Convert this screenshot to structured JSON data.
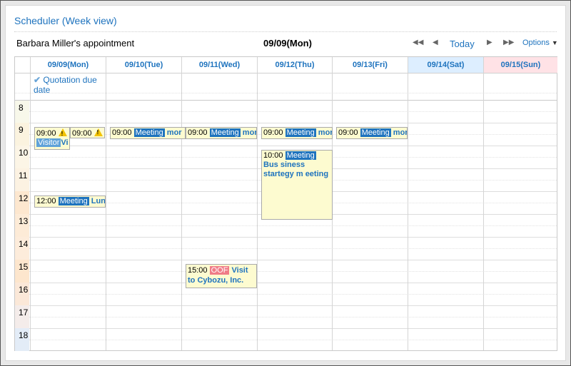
{
  "header": {
    "title": "Scheduler (Week view)",
    "owner": "Barbara Miller's appointment",
    "current_date": "09/09(Mon)",
    "nav": {
      "first": "◀◀",
      "prev": "◀",
      "today": "Today",
      "next": "▶",
      "last": "▶▶",
      "options": "Options",
      "options_caret": "▼"
    }
  },
  "days": [
    {
      "label": "09/09(Mon)"
    },
    {
      "label": "09/10(Tue)"
    },
    {
      "label": "09/11(Wed)"
    },
    {
      "label": "09/12(Thu)"
    },
    {
      "label": "09/13(Fri)"
    },
    {
      "label": "09/14(Sat)"
    },
    {
      "label": "09/15(Sun)"
    }
  ],
  "all_day": [
    {
      "check": "✔",
      "text": "Quotation due date"
    }
  ],
  "hours": [
    "8",
    "9",
    "10",
    "11",
    "12",
    "13",
    "14",
    "15",
    "16",
    "17",
    "18"
  ],
  "colors": {
    "accent": "#1e73be",
    "saturday_bg": "#ddeeff",
    "sunday_bg": "#ffe2e6",
    "event_bg": "#fdfbd0",
    "oof_tag": "#f07c87"
  },
  "events": {
    "mon_visitor": {
      "time": "09:00",
      "tag": "Visitor",
      "title": "Vi"
    },
    "mon_second": {
      "time": "09:00"
    },
    "mon_lunch": {
      "time": "12:00",
      "tag": "Meeting",
      "title": "Lun"
    },
    "tue_meeting": {
      "time": "09:00",
      "tag": "Meeting",
      "title": "mor"
    },
    "wed_meeting": {
      "time": "09:00",
      "tag": "Meeting",
      "title": "mor"
    },
    "wed_visit": {
      "time": "15:00",
      "tag": "OOF",
      "title": "Visit to Cybozu, Inc."
    },
    "thu_meeting": {
      "time": "09:00",
      "tag": "Meeting",
      "title": "mor"
    },
    "thu_business": {
      "time": "10:00",
      "tag": "Meeting",
      "title": "Bus siness startegy m eeting"
    },
    "fri_meeting": {
      "time": "09:00",
      "tag": "Meeting",
      "title": "mor"
    }
  }
}
